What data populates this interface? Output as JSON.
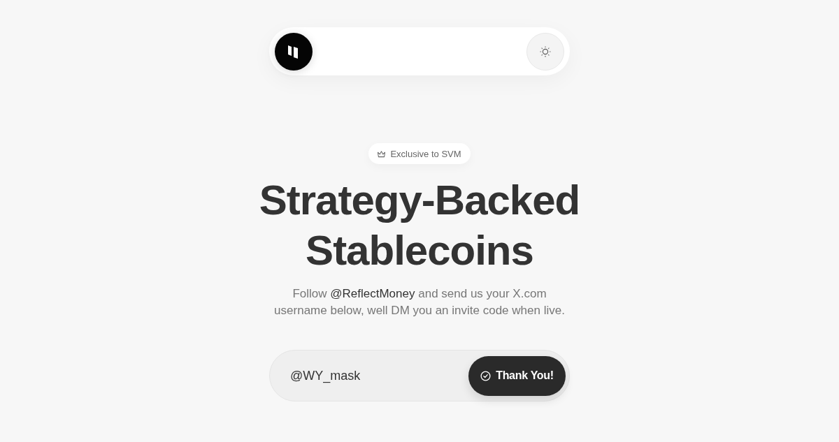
{
  "badge": {
    "label": "Exclusive to SVM"
  },
  "headline": "Strategy-Backed Stablecoins",
  "subtitle": {
    "before": "Follow ",
    "link": "@ReflectMoney",
    "after": " and send us your X.com username below, well DM you an invite code when live."
  },
  "signup": {
    "value": "@WY_mask",
    "button": {
      "label": "Thank You!"
    }
  }
}
